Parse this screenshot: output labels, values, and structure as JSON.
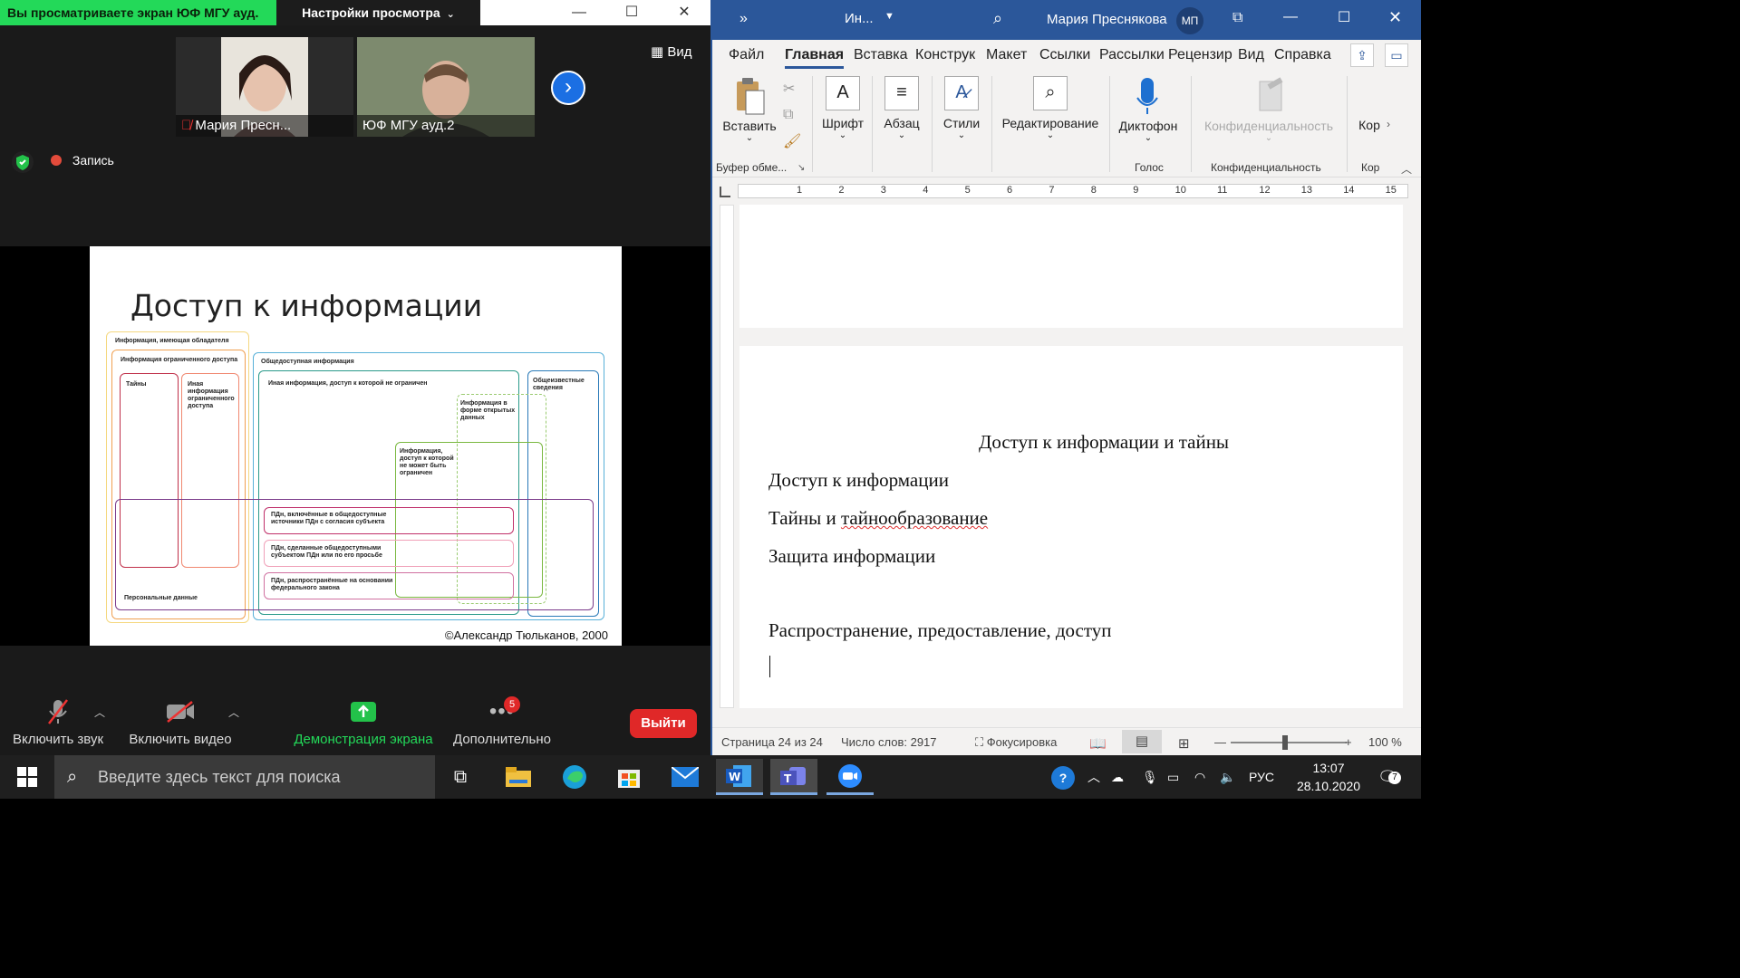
{
  "zoom": {
    "share_banner": "Вы просматриваете экран ЮФ МГУ ауд.",
    "view_settings": "Настройки просмотра",
    "view_button": "Вид",
    "participants": [
      {
        "name": "Мария Пресн...",
        "muted": true
      },
      {
        "name": "ЮФ МГУ ауд.2",
        "muted": false
      }
    ],
    "record_label": "Запись",
    "slide": {
      "title": "Доступ к информации",
      "copyright": "©Александр Тюльканов, 2000",
      "labels": {
        "holder": "Информация, имеющая обладателя",
        "restricted": "Информация ограниченного доступа",
        "secrets": "Тайны",
        "other_restricted": "Иная информация ограниченного доступа",
        "public": "Общедоступная информация",
        "other_unrestricted": "Иная информация, доступ к которой не ограничен",
        "common_knowledge": "Общеизвестные сведения",
        "open_data": "Информация в форме открытых данных",
        "cannot_restrict": "Информация, доступ к которой не может быть ограничен",
        "pd1": "ПДн, включённые в общедоступные источники ПДн с согласия субъекта",
        "pd2": "ПДн, сделанные общедоступными субъектом ПДн или по его просьбе",
        "pd3": "ПДн, распространённые на основании федерального закона",
        "personal": "Персональные данные"
      }
    },
    "toolbar": {
      "mic": "Включить звук",
      "video": "Включить видео",
      "share": "Демонстрация экрана",
      "more": "Дополнительно",
      "more_badge": "5",
      "leave": "Выйти"
    }
  },
  "word": {
    "title_doc": "Ин...",
    "user": "Мария Преснякова",
    "user_initials": "МП",
    "tabs": [
      "Файл",
      "Главная",
      "Вставка",
      "Конструк",
      "Макет",
      "Ссылки",
      "Рассылки",
      "Рецензир",
      "Вид",
      "Справка"
    ],
    "active_tab": "Главная",
    "ribbon": {
      "paste": "Вставить",
      "clipboard_group": "Буфер обме...",
      "font": "Шрифт",
      "paragraph": "Абзац",
      "styles": "Стили",
      "editing": "Редактирование",
      "dictate": "Диктофон",
      "voice_group": "Голос",
      "sensitivity": "Конфиденциальность",
      "sensitivity_group": "Конфиденциальность",
      "cor": "Кор",
      "cor_group": "Кор"
    },
    "ruler_numbers": [
      "1",
      "2",
      "3",
      "4",
      "5",
      "6",
      "7",
      "8",
      "9",
      "10",
      "11",
      "12",
      "13",
      "14",
      "15"
    ],
    "doc": {
      "heading": "Доступ к информации и тайны",
      "lines": [
        "Доступ к информации",
        "Тайны и ",
        "Защита информации",
        "Распространение, предоставление, доступ"
      ],
      "squiggle_word": "тайнообразование"
    },
    "status": {
      "page": "Страница 24 из 24",
      "words": "Число слов: 2917",
      "focus": "Фокусировка",
      "zoom": "100 %"
    }
  },
  "taskbar": {
    "search_placeholder": "Введите здесь текст для поиска",
    "lang": "РУС",
    "time": "13:07",
    "date": "28.10.2020",
    "notifications": "7"
  },
  "colors": {
    "zoom_green": "#23d959",
    "word_blue": "#2b579a",
    "leave_red": "#e02828"
  }
}
